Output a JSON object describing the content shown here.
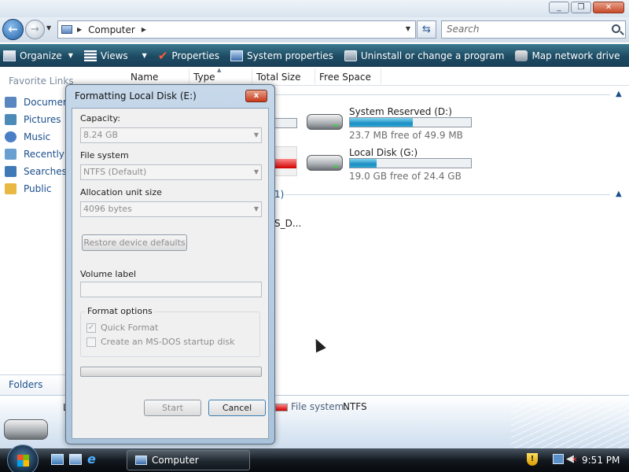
{
  "address": {
    "path": "Computer",
    "search_placeholder": "Search"
  },
  "toolbar": {
    "items": [
      {
        "label": "Organize",
        "icon": "organize-icon"
      },
      {
        "label": "Views",
        "icon": "views-icon"
      },
      {
        "label": "Properties",
        "icon": "properties-icon"
      },
      {
        "label": "System properties",
        "icon": "system-properties-icon"
      },
      {
        "label": "Uninstall or change a program",
        "icon": "uninstall-icon"
      },
      {
        "label": "Map network drive",
        "icon": "map-network-drive-icon"
      }
    ],
    "more": "»"
  },
  "sidebar": {
    "title": "Favorite Links",
    "items": [
      {
        "label": "Documents",
        "icon": "documents-icon",
        "color": "#5a87c0"
      },
      {
        "label": "Pictures",
        "icon": "pictures-icon",
        "color": "#4c8ab8"
      },
      {
        "label": "Music",
        "icon": "music-icon",
        "color": "#4a7fc5"
      },
      {
        "label": "Recently Changed",
        "icon": "recently-changed-icon",
        "color": "#6aa0d0"
      },
      {
        "label": "Searches",
        "icon": "searches-icon",
        "color": "#3f7ab6"
      },
      {
        "label": "Public",
        "icon": "public-folder-icon",
        "color": "#e8b842"
      }
    ],
    "folders_label": "Folders"
  },
  "columns": [
    "Name",
    "Type",
    "Total Size",
    "Free Space"
  ],
  "drives": [
    {
      "name": "System Reserved (D:)",
      "free_text": "23.7 MB free of 49.9 MB",
      "used_fraction": 0.52
    },
    {
      "name": "Local Disk (G:)",
      "free_text": "19.0 GB free of 24.4 GB",
      "used_fraction": 0.22
    }
  ],
  "partial": {
    "group_suffix": "1)",
    "item": "S_D..."
  },
  "details": {
    "name_fragment": "L",
    "fs_label": "File system:",
    "fs_value": "NTFS"
  },
  "dialog": {
    "title": "Formatting Local Disk (E:)",
    "capacity_label": "Capacity:",
    "capacity_value": "8.24 GB",
    "filesystem_label": "File system",
    "filesystem_value": "NTFS (Default)",
    "allocation_label": "Allocation unit size",
    "allocation_value": "4096 bytes",
    "restore_label": "Restore device defaults",
    "volume_label": "Volume label",
    "volume_value": "",
    "format_options_label": "Format options",
    "quick_format_label": "Quick Format",
    "quick_format_checked": true,
    "msdos_label": "Create an MS-DOS startup disk",
    "msdos_checked": false,
    "progress": 0,
    "start_label": "Start",
    "cancel_label": "Cancel",
    "close_glyph": "x"
  },
  "taskbar": {
    "task_label": "Computer",
    "clock": "9:51 PM"
  }
}
